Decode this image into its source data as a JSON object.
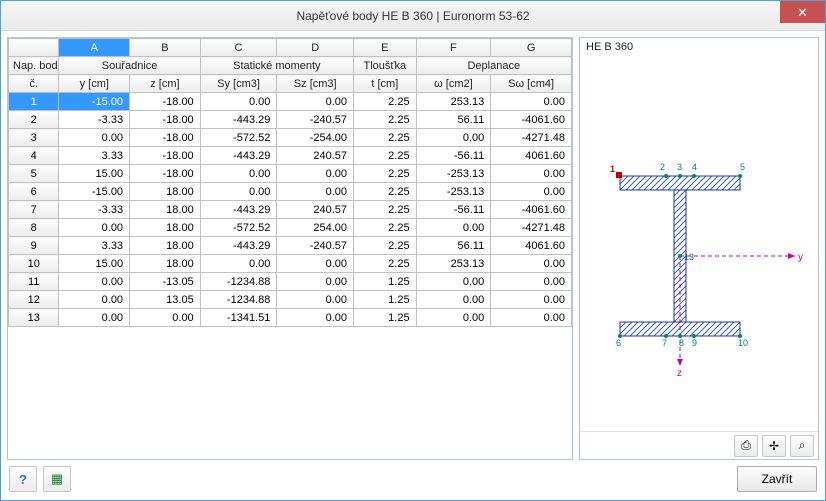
{
  "window": {
    "title": "Napěťové body HE B 360 | Euronorm 53-62",
    "close_btn": "✕"
  },
  "table": {
    "columns_letters": [
      "A",
      "B",
      "C",
      "D",
      "E",
      "F",
      "G"
    ],
    "group_headers": {
      "nap_bod": "Nap. bod",
      "c": "č.",
      "souradnice": "Souřadnice",
      "staticke": "Statické momenty",
      "tloustka": "Tloušťka",
      "deplanace": "Deplanace"
    },
    "sub_headers": {
      "y": "y [cm]",
      "z": "z [cm]",
      "sy": "Sy [cm3]",
      "sz": "Sz [cm3]",
      "t": "t [cm]",
      "omega": "ω [cm2]",
      "somega": "Sω [cm4]"
    },
    "rows": [
      {
        "n": "1",
        "y": "-15.00",
        "z": "-18.00",
        "sy": "0.00",
        "sz": "0.00",
        "t": "2.25",
        "o": "253.13",
        "so": "0.00"
      },
      {
        "n": "2",
        "y": "-3.33",
        "z": "-18.00",
        "sy": "-443.29",
        "sz": "-240.57",
        "t": "2.25",
        "o": "56.11",
        "so": "-4061.60"
      },
      {
        "n": "3",
        "y": "0.00",
        "z": "-18.00",
        "sy": "-572.52",
        "sz": "-254.00",
        "t": "2.25",
        "o": "0.00",
        "so": "-4271.48"
      },
      {
        "n": "4",
        "y": "3.33",
        "z": "-18.00",
        "sy": "-443.29",
        "sz": "240.57",
        "t": "2.25",
        "o": "-56.11",
        "so": "4061.60"
      },
      {
        "n": "5",
        "y": "15.00",
        "z": "-18.00",
        "sy": "0.00",
        "sz": "0.00",
        "t": "2.25",
        "o": "-253.13",
        "so": "0.00"
      },
      {
        "n": "6",
        "y": "-15.00",
        "z": "18.00",
        "sy": "0.00",
        "sz": "0.00",
        "t": "2.25",
        "o": "-253.13",
        "so": "0.00"
      },
      {
        "n": "7",
        "y": "-3.33",
        "z": "18.00",
        "sy": "-443.29",
        "sz": "240.57",
        "t": "2.25",
        "o": "-56.11",
        "so": "-4061.60"
      },
      {
        "n": "8",
        "y": "0.00",
        "z": "18.00",
        "sy": "-572.52",
        "sz": "254.00",
        "t": "2.25",
        "o": "0.00",
        "so": "-4271.48"
      },
      {
        "n": "9",
        "y": "3.33",
        "z": "18.00",
        "sy": "-443.29",
        "sz": "-240.57",
        "t": "2.25",
        "o": "56.11",
        "so": "4061.60"
      },
      {
        "n": "10",
        "y": "15.00",
        "z": "18.00",
        "sy": "0.00",
        "sz": "0.00",
        "t": "2.25",
        "o": "253.13",
        "so": "0.00"
      },
      {
        "n": "11",
        "y": "0.00",
        "z": "-13.05",
        "sy": "-1234.88",
        "sz": "0.00",
        "t": "1.25",
        "o": "0.00",
        "so": "0.00"
      },
      {
        "n": "12",
        "y": "0.00",
        "z": "13.05",
        "sy": "-1234.88",
        "sz": "0.00",
        "t": "1.25",
        "o": "0.00",
        "so": "0.00"
      },
      {
        "n": "13",
        "y": "0.00",
        "z": "0.00",
        "sy": "-1341.51",
        "sz": "0.00",
        "t": "1.25",
        "o": "0.00",
        "so": "0.00"
      }
    ]
  },
  "preview": {
    "title": "HE B 360",
    "points": [
      "1",
      "2",
      "3",
      "4",
      "5",
      "6",
      "7",
      "8",
      "9",
      "10",
      "13"
    ],
    "axis_y": "y",
    "axis_z": "z"
  },
  "footer": {
    "close_label": "Zavřít"
  },
  "icons": {
    "help": "?",
    "excel": "▦",
    "print": "⎙",
    "axes": "✢",
    "zoom": "⌕"
  }
}
